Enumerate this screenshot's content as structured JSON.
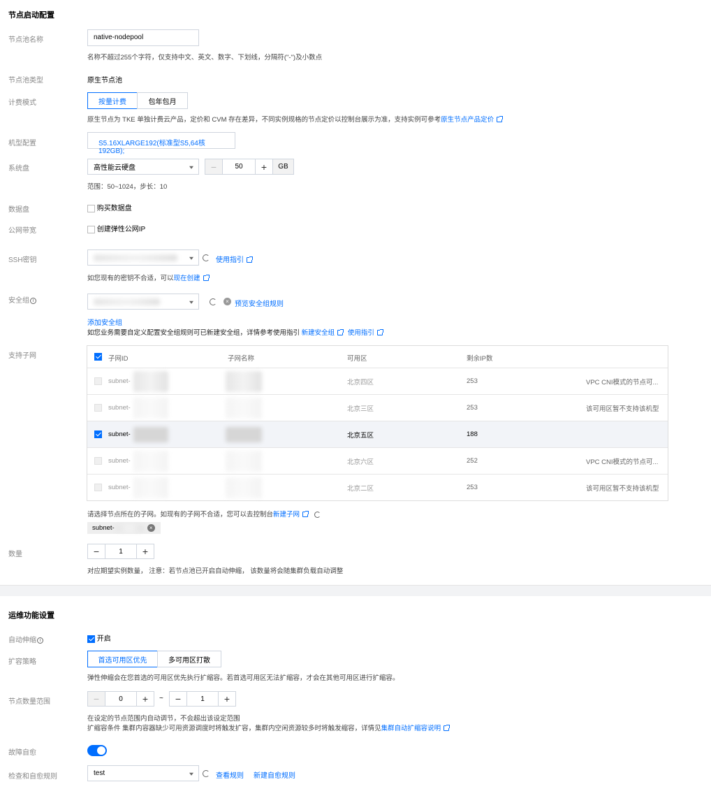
{
  "s1": {
    "title": "节点启动配置",
    "pool_name": {
      "label": "节点池名称",
      "value": "native-nodepool",
      "hint": "名称不超过255个字符，仅支持中文、英文、数字、下划线，分隔符(\"-\")及小数点"
    },
    "pool_type": {
      "label": "节点池类型",
      "value": "原生节点池"
    },
    "billing": {
      "label": "计费模式",
      "options": [
        "按量计费",
        "包年包月"
      ],
      "hint_prefix": "原生节点为 TKE 单独计费云产品，定价和 CVM 存在差异，不同实例规格的节点定价以控制台展示为准，支持实例可参考",
      "hint_link": "原生节点产品定价"
    },
    "model": {
      "label": "机型配置",
      "value": "S5.16XLARGE192(标准型S5,64核192GB);"
    },
    "sysdisk": {
      "label": "系统盘",
      "type": "高性能云硬盘",
      "size": "50",
      "unit": "GB",
      "hint": "范围：50~1024，步长：10"
    },
    "datadisk": {
      "label": "数据盘",
      "checkbox": "购买数据盘"
    },
    "bandwidth": {
      "label": "公网带宽",
      "checkbox": "创建弹性公网IP"
    },
    "ssh": {
      "label": "SSH密钥",
      "guide": "使用指引",
      "hint_prefix": "如您现有的密钥不合适，可以",
      "hint_link": "现在创建"
    },
    "secgroup": {
      "label": "安全组",
      "preview": "预览安全组规则",
      "add": "添加安全组",
      "hint_prefix": "如您业务需要自定义配置安全组规则可已新建安全组，详情参考使用指引",
      "new_link": "新建安全组",
      "guide": "使用指引"
    },
    "subnet": {
      "label": "支持子网",
      "headers": [
        "子网ID",
        "子网名称",
        "可用区",
        "剩余IP数"
      ],
      "rows": [
        {
          "id": "subnet-",
          "zone": "北京四区",
          "ips": "253",
          "note": "VPC CNI模式的节点可..."
        },
        {
          "id": "subnet-",
          "zone": "北京三区",
          "ips": "253",
          "note": "该可用区暂不支持该机型"
        },
        {
          "id": "subnet-",
          "zone": "北京五区",
          "ips": "188",
          "note": ""
        },
        {
          "id": "subnet-",
          "zone": "北京六区",
          "ips": "252",
          "note": "VPC CNI模式的节点可..."
        },
        {
          "id": "subnet-",
          "zone": "北京二区",
          "ips": "253",
          "note": "该可用区暂不支持该机型"
        }
      ],
      "hint_prefix": "请选择节点所在的子网。如现有的子网不合适，您可以去控制台",
      "hint_link": "新建子网",
      "tag": "subnet-"
    },
    "count": {
      "label": "数量",
      "value": "1",
      "hint": "对应期望实例数量， 注意：若节点池已开启自动伸缩， 该数量将会随集群负载自动调整"
    }
  },
  "s2": {
    "title": "运维功能设置",
    "autoscale": {
      "label": "自动伸缩",
      "checkbox": "开启"
    },
    "strategy": {
      "label": "扩容策略",
      "options": [
        "首选可用区优先",
        "多可用区打散"
      ],
      "hint": "弹性伸缩会在您首选的可用区优先执行扩缩容。若首选可用区无法扩缩容，才会在其他可用区进行扩缩容。"
    },
    "range": {
      "label": "节点数量范围",
      "min": "0",
      "max": "1",
      "sep": "~",
      "hint1": "在设定的节点范围内自动调节，不会超出该设定范围",
      "hint2_prefix": "扩缩容条件 集群内容器缺少可用资源调度时将触发扩容，集群内空闲资源较多时将触发缩容，详情见",
      "hint2_link": "集群自动扩缩容说明"
    },
    "selfheal": {
      "label": "故障自愈"
    },
    "rules": {
      "label": "检查和自愈规则",
      "value": "test",
      "view": "查看规则",
      "create": "新建自愈规则"
    }
  },
  "colors": {
    "accent": "#006eff",
    "label": "#888888"
  },
  "icons": [
    "refresh-icon",
    "external-link-icon",
    "info-icon",
    "close-circle-icon",
    "check-icon",
    "caret-down-icon"
  ]
}
